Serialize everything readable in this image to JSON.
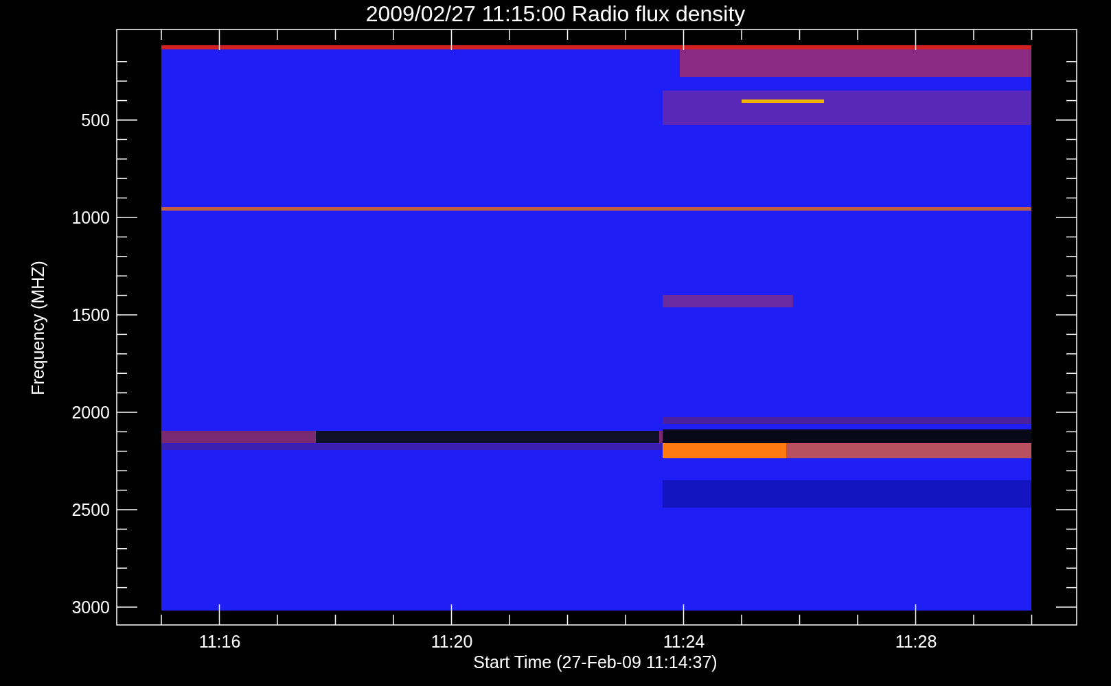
{
  "title": "2009/02/27 11:15:00 Radio flux density",
  "y_axis": {
    "label": "Frequency (MHZ)",
    "tick_labels": [
      "500",
      "1000",
      "1500",
      "2000",
      "2500",
      "3000"
    ]
  },
  "x_axis": {
    "label": "Start Time (27-Feb-09 11:14:37)",
    "tick_labels": [
      "11:16",
      "11:20",
      "11:24",
      "11:28"
    ]
  }
}
